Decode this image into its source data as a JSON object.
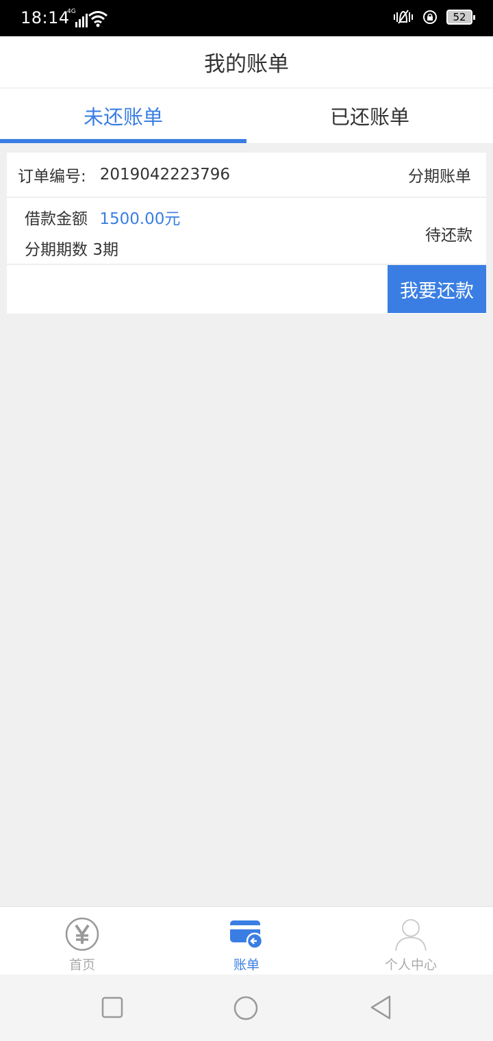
{
  "status_bar": {
    "time": "18:14",
    "network": "4G",
    "battery": "52"
  },
  "header": {
    "title": "我的账单"
  },
  "tabs": [
    {
      "label": "未还账单",
      "active": true
    },
    {
      "label": "已还账单",
      "active": false
    }
  ],
  "bill_card": {
    "order_label": "订单编号:",
    "order_number": "2019042223796",
    "bill_type": "分期账单",
    "loan_amount_label": "借款金额",
    "loan_amount": "1500.00元",
    "installments_label": "分期期数",
    "installments": "3期",
    "status": "待还款",
    "repay_button": "我要还款"
  },
  "bottom_nav": [
    {
      "label": "首页",
      "icon": "yuan-icon",
      "active": false
    },
    {
      "label": "账单",
      "icon": "bill-card-icon",
      "active": true
    },
    {
      "label": "个人中心",
      "icon": "user-icon",
      "active": false
    }
  ],
  "colors": {
    "accent": "#3a7ee3",
    "background": "#f0f0f0",
    "inactive": "#aaaaaa"
  }
}
